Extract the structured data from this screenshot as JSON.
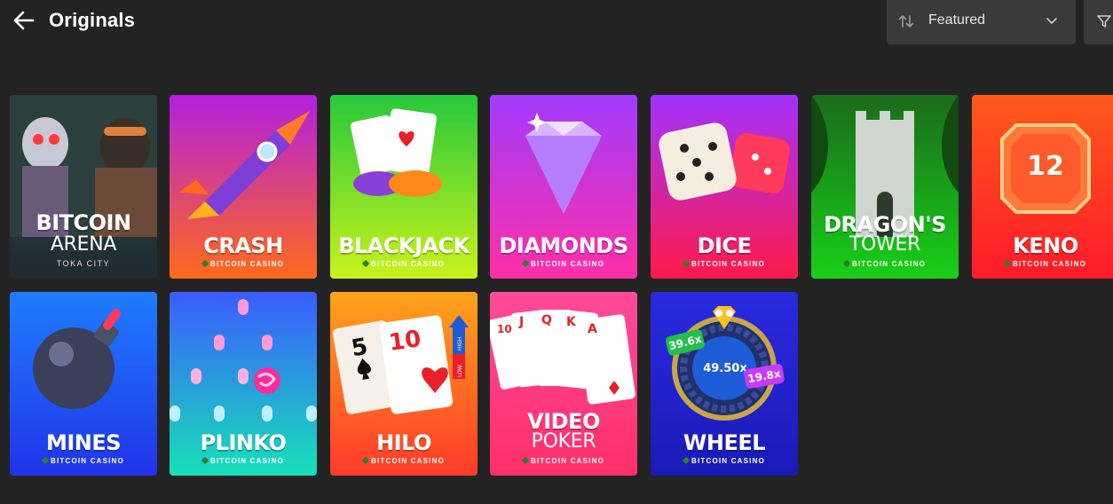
{
  "header": {
    "title": "Originals",
    "sort": {
      "selected": "Featured"
    }
  },
  "games": [
    {
      "name": "BITCOIN",
      "name2": "ARENA",
      "sub": "TOKA CITY",
      "brand": "",
      "bg": [
        "#2f4d4a",
        "#1e2a33"
      ]
    },
    {
      "name": "CRASH",
      "name2": "",
      "sub": "",
      "brand": "BITCOIN CASINO",
      "bg": [
        "#b31fe0",
        "#ff6a1a"
      ]
    },
    {
      "name": "BLACKJACK",
      "name2": "",
      "sub": "",
      "brand": "BITCOIN CASINO",
      "bg": [
        "#27c93b",
        "#c9f21a"
      ]
    },
    {
      "name": "DIAMONDS",
      "name2": "",
      "sub": "",
      "brand": "BITCOIN CASINO",
      "bg": [
        "#a23bff",
        "#ff2fa6"
      ]
    },
    {
      "name": "DICE",
      "name2": "",
      "sub": "",
      "brand": "BITCOIN CASINO",
      "bg": [
        "#a331ff",
        "#ff1a4a"
      ]
    },
    {
      "name": "DRAGON'S",
      "name2": "TOWER",
      "sub": "",
      "brand": "BITCOIN CASINO",
      "bg": [
        "#1b6b1b",
        "#18d018"
      ]
    },
    {
      "name": "KENO",
      "name2": "",
      "sub": "",
      "brand": "BITCOIN CASINO",
      "bg": [
        "#ff5a1a",
        "#ff1a2a"
      ]
    },
    {
      "name": "MINES",
      "name2": "",
      "sub": "",
      "brand": "BITCOIN CASINO",
      "bg": [
        "#1e7dff",
        "#2133e8"
      ]
    },
    {
      "name": "PLINKO",
      "name2": "",
      "sub": "",
      "brand": "BITCOIN CASINO",
      "bg": [
        "#3a5cff",
        "#17e0b8"
      ]
    },
    {
      "name": "HILO",
      "name2": "",
      "sub": "",
      "brand": "BITCOIN CASINO",
      "bg": [
        "#ffa41a",
        "#ff3a2a"
      ]
    },
    {
      "name": "VIDEO",
      "name2": "POKER",
      "sub": "",
      "brand": "BITCOIN CASINO",
      "bg": [
        "#ff4a9a",
        "#ff2f6a"
      ]
    },
    {
      "name": "WHEEL",
      "name2": "",
      "sub": "",
      "brand": "BITCOIN CASINO",
      "bg": [
        "#2a2ae0",
        "#1a1ab8"
      ]
    }
  ],
  "art": {
    "keno_number": "12",
    "hilo": {
      "card1": "5",
      "card2": "10",
      "high": "HIGH",
      "low": "LOW"
    },
    "poker": [
      "10",
      "J",
      "Q",
      "K",
      "A"
    ],
    "wheel": {
      "m1": "39.6x",
      "m2": "49.50x",
      "m3": "19.8x"
    }
  }
}
